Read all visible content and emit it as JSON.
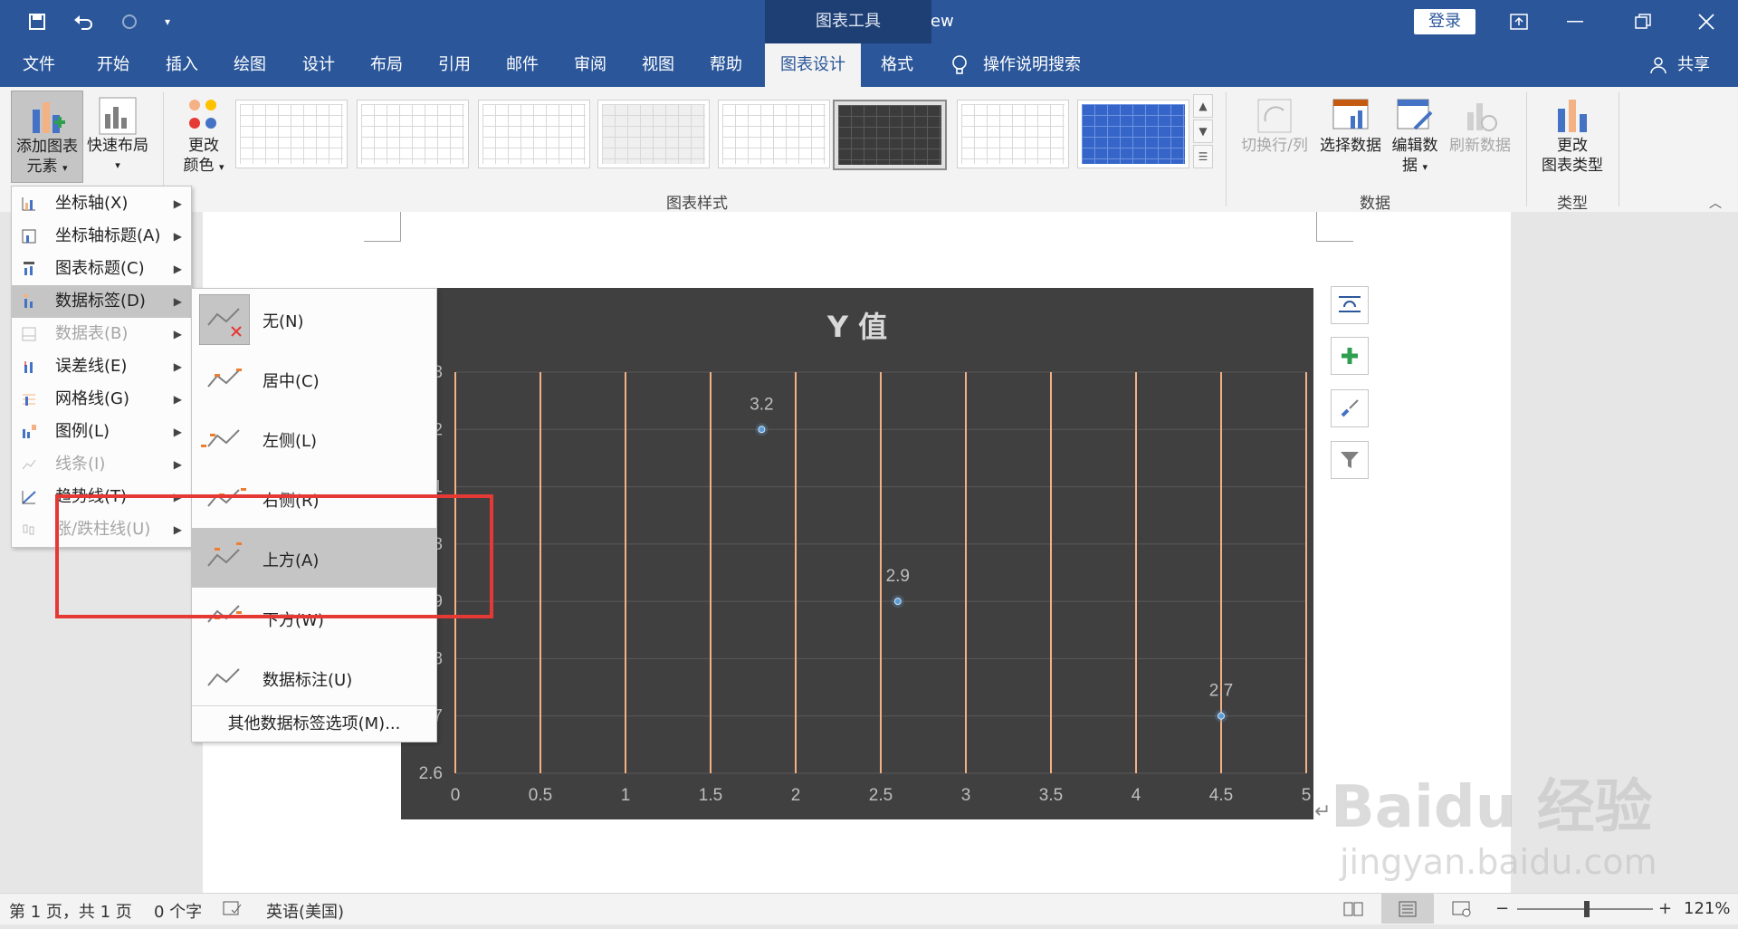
{
  "titlebar": {
    "doc_title": "文档1  -  Word Preview",
    "context_tools": "图表工具",
    "login": "登录",
    "icons": [
      "save-icon",
      "undo-icon",
      "redo-icon",
      "customize-qat-icon"
    ]
  },
  "tabs": [
    "文件",
    "开始",
    "插入",
    "绘图",
    "设计",
    "布局",
    "引用",
    "邮件",
    "审阅",
    "视图",
    "帮助",
    "图表设计",
    "格式"
  ],
  "active_tab": "图表设计",
  "search_label": "操作说明搜索",
  "share_label": "共享",
  "ribbon": {
    "add_element": "添加图表元素",
    "add_element_line1": "添加图表",
    "add_element_line2": "元素",
    "quick_layout": "快速布局",
    "change_color_line1": "更改",
    "change_color_line2": "颜色",
    "styles_group": "图表样式",
    "switch_rowcol": "切换行/列",
    "select_data": "选择数据",
    "edit_data_line1": "编辑数",
    "edit_data_line2": "据",
    "refresh_data": "刷新数据",
    "data_group": "数据",
    "change_type_line1": "更改",
    "change_type_line2": "图表类型",
    "type_group": "类型"
  },
  "menu_elements": [
    {
      "label": "坐标轴(X)",
      "enabled": true
    },
    {
      "label": "坐标轴标题(A)",
      "enabled": true
    },
    {
      "label": "图表标题(C)",
      "enabled": true
    },
    {
      "label": "数据标签(D)",
      "enabled": true,
      "highlighted": true
    },
    {
      "label": "数据表(B)",
      "enabled": false
    },
    {
      "label": "误差线(E)",
      "enabled": true
    },
    {
      "label": "网格线(G)",
      "enabled": true
    },
    {
      "label": "图例(L)",
      "enabled": true
    },
    {
      "label": "线条(I)",
      "enabled": false
    },
    {
      "label": "趋势线(T)",
      "enabled": true
    },
    {
      "label": "涨/跌柱线(U)",
      "enabled": false
    }
  ],
  "menu_labels": [
    {
      "label": "无(N)"
    },
    {
      "label": "居中(C)"
    },
    {
      "label": "左侧(L)"
    },
    {
      "label": "右侧(R)"
    },
    {
      "label": "上方(A)",
      "highlighted": true
    },
    {
      "label": "下方(W)"
    },
    {
      "label": "数据标注(U)"
    }
  ],
  "menu_more": "其他数据标签选项(M)...",
  "chart_data": {
    "type": "scatter",
    "title": "Y 值",
    "x": [
      1.8,
      2.6,
      4.5
    ],
    "y": [
      3.2,
      2.9,
      2.7
    ],
    "data_labels": [
      "3.2",
      "2.9",
      "2.7"
    ],
    "xlim": [
      0,
      5
    ],
    "ylim": [
      2.6,
      3.3
    ],
    "x_ticks": [
      "0",
      "0.5",
      "1",
      "1.5",
      "2",
      "2.5",
      "3",
      "3.5",
      "4",
      "4.5",
      "5"
    ],
    "y_ticks": [
      "2.6",
      "2.7",
      "2.8",
      "2.9",
      "3",
      "3.1",
      "3.2",
      "3.3"
    ],
    "grid": true,
    "colors": {
      "background": "#404040",
      "vertical_grid": "#f4b183",
      "horizontal_grid": "#595959",
      "point": "#5b9bd5",
      "text": "#bfbfbf"
    }
  },
  "status": {
    "page": "第 1 页，共 1 页",
    "words": "0 个字",
    "language": "英语(美国)",
    "zoom": "121%"
  },
  "watermark": {
    "logo": "Baidu 经验",
    "url": "jingyan.baidu.com"
  },
  "accent_color": "#2b579a",
  "highlight_box_color": "#e53935"
}
